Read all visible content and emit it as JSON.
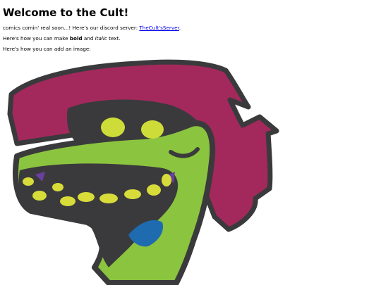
{
  "page": {
    "title": "Welcome to the Cult!",
    "line1_text": "comics comin' real soon...! Here's our discord server: ",
    "discord_link_text": "TheCult'sServer",
    "line1_suffix": ".",
    "line2_prefix": "Here's how you can make ",
    "line2_bold": "bold",
    "line2_middle": " and ",
    "line2_italic": "italic",
    "line2_suffix": " text.",
    "line3_text": "Here's how you can add an image:"
  },
  "colors": {
    "link": "#0000ee",
    "hair": "#a3295c",
    "skin": "#8bc43f",
    "outline": "#3a3a3c",
    "eye": "#cddc39",
    "teeth": "#d7dc3a",
    "gums": "#6a3fa0",
    "tongue": "#1f6bb0"
  },
  "image": {
    "icon": "cult-mascot-face-image"
  }
}
